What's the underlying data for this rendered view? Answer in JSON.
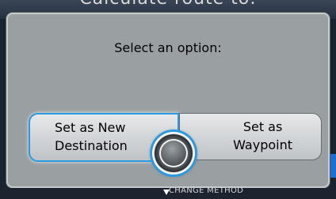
{
  "background": {
    "title": "Calculate route to:"
  },
  "dialog": {
    "prompt": "Select an option:",
    "options": [
      {
        "line1": "Set as New",
        "line2": "Destination",
        "selected": true
      },
      {
        "line1": "Set as",
        "line2": "Waypoint",
        "selected": false
      }
    ]
  },
  "footer": {
    "hint": "CHANGE METHOD"
  },
  "colors": {
    "accent": "#2a9be2",
    "dialog_bg": "#9aa0a2",
    "screen_bg": "#1a2330"
  }
}
